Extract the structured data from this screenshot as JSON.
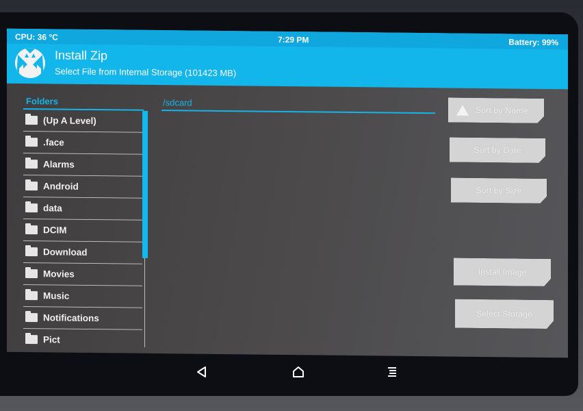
{
  "status": {
    "cpu": "CPU: 36 °C",
    "time": "7:29 PM",
    "battery": "Battery: 99%"
  },
  "header": {
    "title": "Install Zip",
    "subtitle": "Select File from Internal Storage (101423 MB)",
    "logo_icon": "twrp-logo-icon"
  },
  "colors": {
    "accent": "#13b6ea",
    "button_bg": "#d4d4d4",
    "panel_bg": "#4a4848"
  },
  "folders": {
    "label": "Folders",
    "items": [
      {
        "label": "(Up A Level)"
      },
      {
        "label": ".face"
      },
      {
        "label": "Alarms"
      },
      {
        "label": "Android"
      },
      {
        "label": "data"
      },
      {
        "label": "DCIM"
      },
      {
        "label": "Download"
      },
      {
        "label": "Movies"
      },
      {
        "label": "Music"
      },
      {
        "label": "Notifications"
      },
      {
        "label": "Pict"
      }
    ],
    "scroll_fraction_visible": 0.62
  },
  "files": {
    "path": "/sdcard"
  },
  "buttons": {
    "sort_name": "Sort by Name",
    "sort_date": "Sort by Date",
    "sort_size": "Sort by Size",
    "install_image": "Install Image",
    "select_storage": "Select Storage"
  },
  "navbar": {
    "back": "back-icon",
    "home": "home-icon",
    "menu": "menu-icon"
  }
}
